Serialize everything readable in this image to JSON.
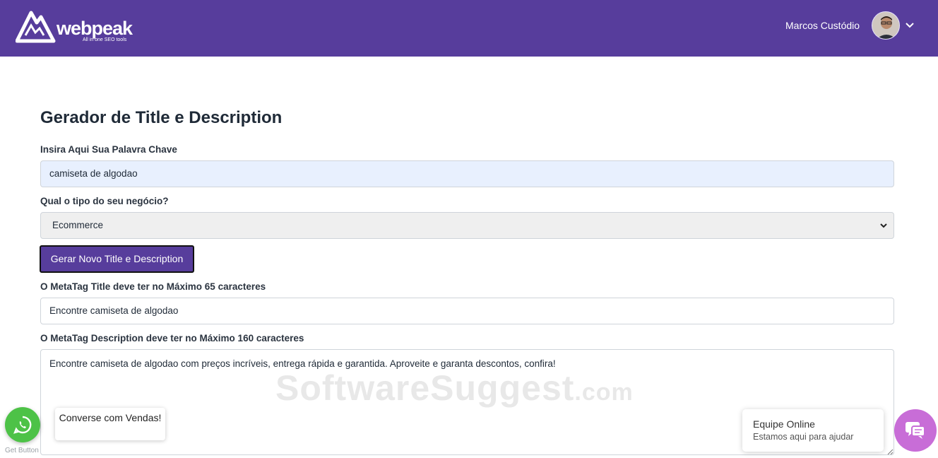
{
  "header": {
    "logo_name": "webpeak",
    "logo_tagline": "All in one SEO tools",
    "user_name": "Marcos Custódio",
    "avatar_icon": "user-avatar",
    "menu_icon": "chevron-down-icon",
    "bg_color": "#573d9c"
  },
  "form": {
    "title": "Gerador de Title e Description",
    "keyword_label": "Insira Aqui Sua Palavra Chave",
    "keyword_value": "camiseta de algodao",
    "business_label": "Qual o tipo do seu negócio?",
    "business_value": "Ecommerce",
    "generate_button": "Gerar Novo Title e Description",
    "meta_title_label": "O MetaTag Title deve ter no Máximo 65 caracteres",
    "meta_title_value": "Encontre camiseta de algodao",
    "meta_desc_label": "O MetaTag Description deve ter no Máximo 160 caracteres",
    "meta_desc_value": "Encontre camiseta de algodao com preços incríveis, entrega rápida e garantida. Aproveite e garanta descontos, confira!"
  },
  "watermark": {
    "main": "SoftwareSuggest",
    "suffix": ".com"
  },
  "whatsapp": {
    "icon": "whatsapp-icon",
    "bubble_text": "Converse com Vendas!",
    "credit": "Get Button",
    "color": "#4dc247"
  },
  "chat": {
    "status": "Equipe Online",
    "subtitle": "Estamos aqui para ajudar",
    "icon": "chat-icon",
    "color": "#c86dd7"
  }
}
